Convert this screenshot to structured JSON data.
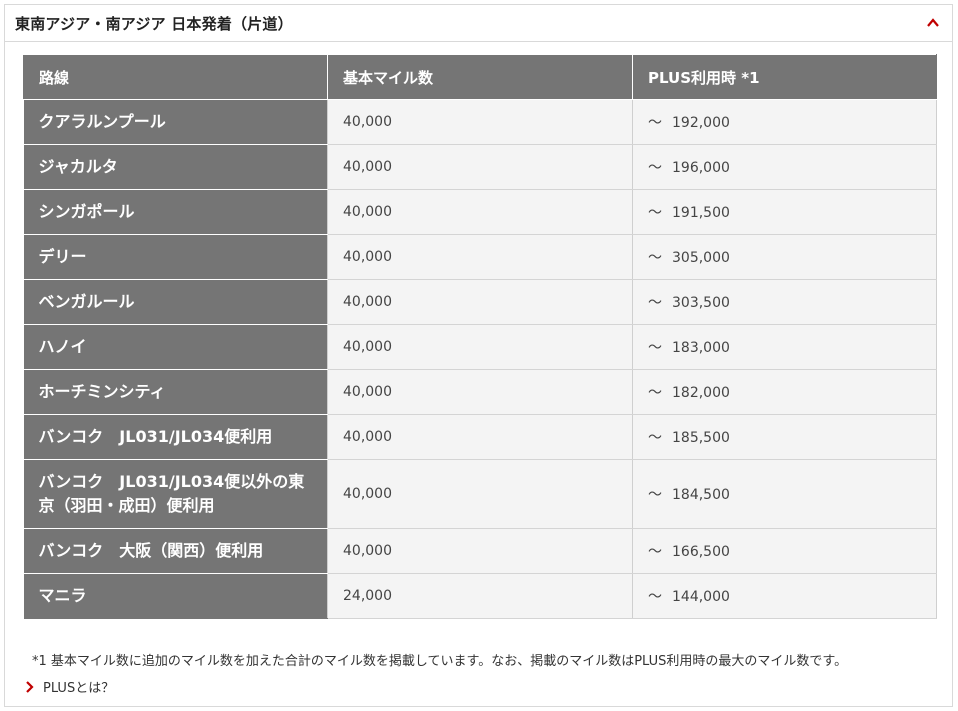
{
  "panel": {
    "title": "東南アジア・南アジア 日本発着（片道）",
    "accent_color": "#c00000"
  },
  "table": {
    "headers": [
      "路線",
      "基本マイル数",
      "PLUS利用時 *1"
    ],
    "rows": [
      {
        "route": "クアラルンプール",
        "base": "40,000",
        "tilde": "～",
        "plus": "192,000"
      },
      {
        "route": "ジャカルタ",
        "base": "40,000",
        "tilde": "～",
        "plus": "196,000"
      },
      {
        "route": "シンガポール",
        "base": "40,000",
        "tilde": "～",
        "plus": "191,500"
      },
      {
        "route": "デリー",
        "base": "40,000",
        "tilde": "～",
        "plus": "305,000"
      },
      {
        "route": "ベンガルール",
        "base": "40,000",
        "tilde": "～",
        "plus": "303,500"
      },
      {
        "route": "ハノイ",
        "base": "40,000",
        "tilde": "～",
        "plus": "183,000"
      },
      {
        "route": "ホーチミンシティ",
        "base": "40,000",
        "tilde": "～",
        "plus": "182,000"
      },
      {
        "route": "バンコク　JL031/JL034便利用",
        "base": "40,000",
        "tilde": "～",
        "plus": "185,500"
      },
      {
        "route": "バンコク　JL031/JL034便以外の東京（羽田・成田）便利用",
        "base": "40,000",
        "tilde": "～",
        "plus": "184,500"
      },
      {
        "route": "バンコク　大阪（関西）便利用",
        "base": "40,000",
        "tilde": "～",
        "plus": "166,500"
      },
      {
        "route": "マニラ",
        "base": "24,000",
        "tilde": "～",
        "plus": "144,000"
      }
    ]
  },
  "footnote": "*1  基本マイル数に追加のマイル数を加えた合計のマイル数を掲載しています。なお、掲載のマイル数はPLUS利用時の最大のマイル数です。",
  "link": {
    "label": "PLUSとは？",
    "icon": "chevron-right-icon"
  }
}
